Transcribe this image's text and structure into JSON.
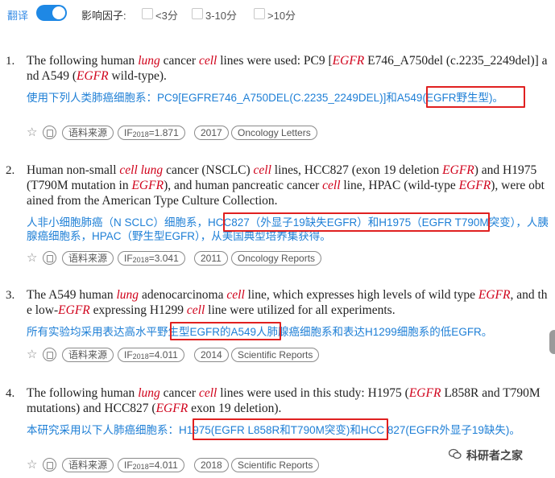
{
  "toolbar": {
    "translate_label": "翻译",
    "translate_on": true,
    "impact_label": "影响因子:",
    "filters": [
      "<3分",
      "3-10分",
      ">10分"
    ]
  },
  "results": [
    {
      "num": "1.",
      "en": [
        [
          "The following human ",
          false
        ],
        [
          "lung",
          true
        ],
        [
          " cancer ",
          false
        ],
        [
          "cell",
          true
        ],
        [
          " lines were used: PC9 [",
          false
        ],
        [
          "EGFR",
          true
        ],
        [
          " E746_A750del (c.2235_2249del)] and A549 (",
          false
        ],
        [
          "EGFR",
          true
        ],
        [
          " wild-type).",
          false
        ]
      ],
      "zh": "使用下列人类肺癌细胞系：PC9[EGFRE746_A750DEL(C.2235_2249DEL)]和A549(EGFR野生型)。",
      "tags": {
        "source": "语料来源",
        "if_prefix": "IF",
        "if_sub": "2018",
        "if_val": "=1.871",
        "year": "2017",
        "journal": "Oncology Letters"
      }
    },
    {
      "num": "2.",
      "en": [
        [
          "Human non-small ",
          false
        ],
        [
          "cell",
          true
        ],
        [
          " ",
          false
        ],
        [
          "lung",
          true
        ],
        [
          " cancer (NSCLC) ",
          false
        ],
        [
          "cell",
          true
        ],
        [
          " lines, HCC827 (exon 19 deletion ",
          false
        ],
        [
          "EGFR",
          true
        ],
        [
          ") and H1975 (T790M mutation in ",
          false
        ],
        [
          "EGFR",
          true
        ],
        [
          "), and human pancreatic cancer ",
          false
        ],
        [
          "cell",
          true
        ],
        [
          " line, HPAC (wild-type ",
          false
        ],
        [
          "EGFR",
          true
        ],
        [
          "), were obtained from the American Type Culture Collection.",
          false
        ]
      ],
      "zh": "人非小细胞肺癌（N SCLC）细胞系，HCC827（外显子19缺失EGFR）和H1975（EGFR T790M突变），人胰腺癌细胞系，HPAC（野生型EGFR），从美国典型培养集获得。",
      "tags": {
        "source": "语料来源",
        "if_prefix": "IF",
        "if_sub": "2018",
        "if_val": "=3.041",
        "year": "2011",
        "journal": "Oncology Reports"
      }
    },
    {
      "num": "3.",
      "en": [
        [
          "The A549 human ",
          false
        ],
        [
          "lung",
          true
        ],
        [
          " adenocarcinoma ",
          false
        ],
        [
          "cell",
          true
        ],
        [
          " line, which expresses high levels of wild type ",
          false
        ],
        [
          "EGFR",
          true
        ],
        [
          ", and the low-",
          false
        ],
        [
          "EGFR",
          true
        ],
        [
          " expressing H1299 ",
          false
        ],
        [
          "cell",
          true
        ],
        [
          " line were utilized for all experiments.",
          false
        ]
      ],
      "zh": "所有实验均采用表达高水平野生型EGFR的A549人肺腺癌细胞系和表达H1299细胞系的低EGFR。",
      "tags": {
        "source": "语料来源",
        "if_prefix": "IF",
        "if_sub": "2018",
        "if_val": "=4.011",
        "year": "2014",
        "journal": "Scientific Reports"
      }
    },
    {
      "num": "4.",
      "en": [
        [
          "The following human ",
          false
        ],
        [
          "lung",
          true
        ],
        [
          " cancer ",
          false
        ],
        [
          "cell",
          true
        ],
        [
          " lines were used in this study: H1975 (",
          false
        ],
        [
          "EGFR",
          true
        ],
        [
          " L858R and T790M mutations) and HCC827 (",
          false
        ],
        [
          "EGFR",
          true
        ],
        [
          " exon 19 deletion).",
          false
        ]
      ],
      "zh": "本研究采用以下人肺癌细胞系：H1975(EGFR L858R和T790M突变)和HCC 827(EGFR外显子19缺失)。",
      "tags": {
        "source": "语料来源",
        "if_prefix": "IF",
        "if_sub": "2018",
        "if_val": "=4.011",
        "year": "2018",
        "journal": "Scientific Reports"
      }
    }
  ],
  "watermark": "科研者之家"
}
